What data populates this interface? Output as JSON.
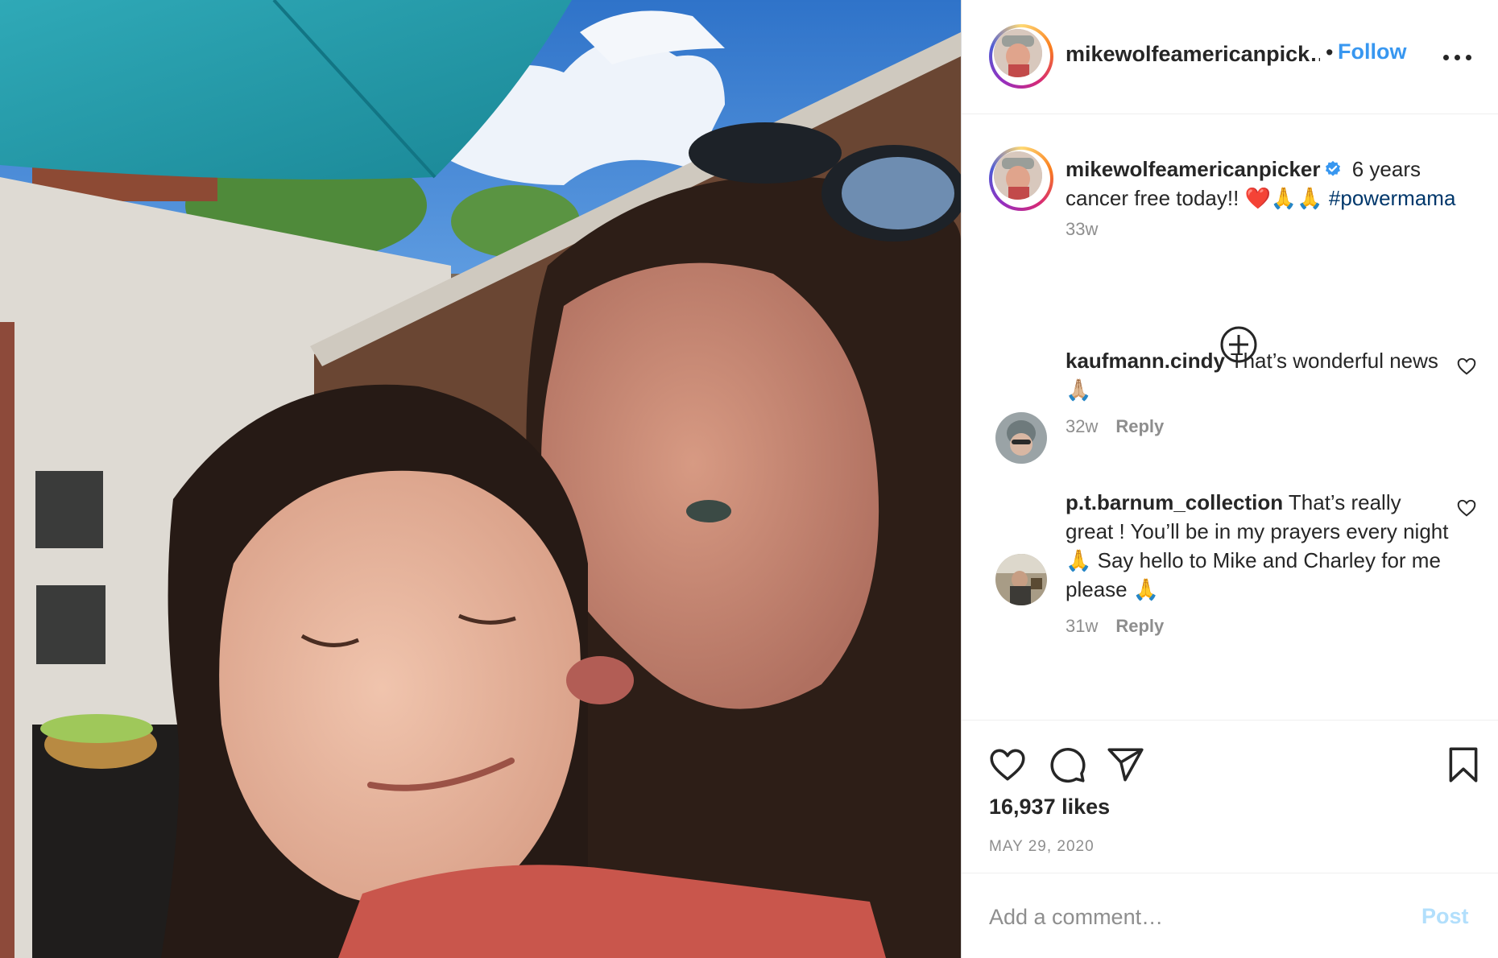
{
  "post": {
    "username": "mikewolfeamericanpicker",
    "header_username": "mikewolfeamericanpick…",
    "follow_label": "Follow",
    "caption": {
      "text": " 6 years cancer free today!! ❤️🙏🙏 ",
      "hashtag": "#powermama",
      "time": "33w"
    },
    "comments": [
      {
        "username": "kaufmann.cindy",
        "text": " That’s wonderful news 🙏🏼",
        "time": "32w",
        "reply_label": "Reply"
      },
      {
        "username": "p.t.barnum_collection",
        "text": " That’s really great ! You’ll be in my prayers every night 🙏 Say hello to Mike and Charley for me please 🙏",
        "time": "31w",
        "reply_label": "Reply"
      }
    ],
    "likes": "16,937 likes",
    "date": "MAY 29, 2020",
    "comment_input": {
      "placeholder": "Add a comment…",
      "value": ""
    },
    "post_label": "Post"
  },
  "icons": {
    "more": "more-options-icon",
    "verified": "verified-badge-icon",
    "load_more": "plus-circle-icon",
    "like": "heart-icon",
    "comment": "comment-icon",
    "share": "paper-plane-icon",
    "save": "bookmark-icon"
  },
  "colors": {
    "follow": "#3897f0",
    "hashtag": "#00376b",
    "muted": "#8e8e8e",
    "post_disabled": "#b2dffc"
  }
}
